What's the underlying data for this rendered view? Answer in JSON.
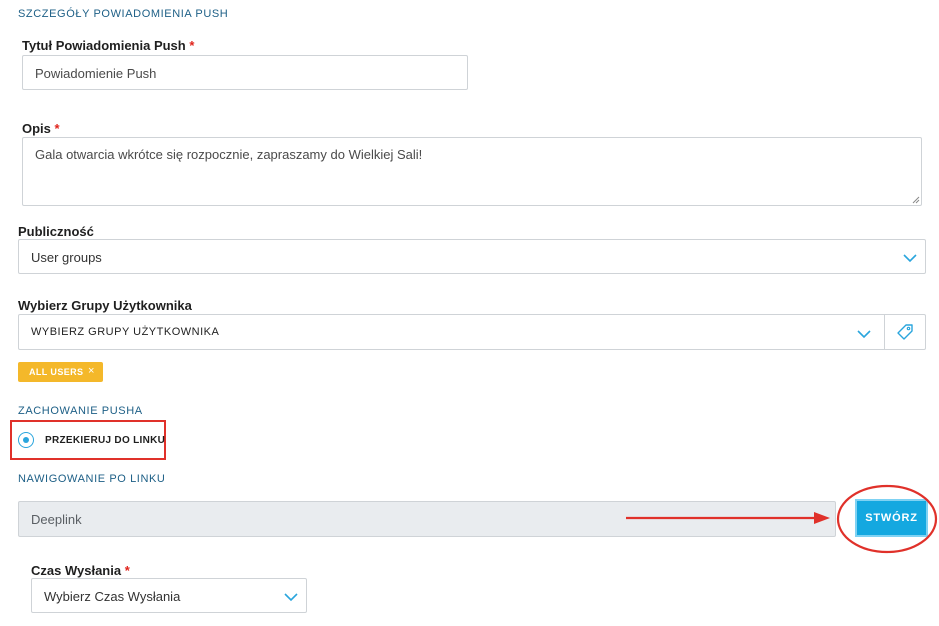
{
  "section_push_details": "SZCZEGÓŁY POWIADOMIENIA PUSH",
  "title_field": {
    "label": "Tytuł Powiadomienia Push",
    "required_mark": "*",
    "value": "Powiadomienie Push"
  },
  "description_field": {
    "label": "Opis",
    "required_mark": "*",
    "value": "Gala otwarcia wkrótce się rozpocznie, zapraszamy do Wielkiej Sali!"
  },
  "audience_field": {
    "label": "Publiczność",
    "value": "User groups"
  },
  "user_groups_field": {
    "label": "Wybierz Grupy Użytkownika",
    "placeholder": "WYBIERZ GRUPY UŻYTKOWNIKA",
    "tags": [
      {
        "label": "ALL USERS",
        "remove": "×"
      }
    ]
  },
  "section_push_behavior": "ZACHOWANIE PUSHA",
  "behavior_option": {
    "label": "PRZEKIERUJ DO LINKU",
    "selected": true
  },
  "section_link_nav": "NAWIGOWANIE PO LINKU",
  "link_field": {
    "value": "Deeplink"
  },
  "create_button": {
    "label": "STWÓRZ"
  },
  "send_time_field": {
    "label": "Czas Wysłania",
    "required_mark": "*",
    "value": "Wybierz Czas Wysłania"
  },
  "colors": {
    "accent_blue": "#14a8e0",
    "section_title": "#1d5f86",
    "tag_yellow": "#f4b82a",
    "annotation_red": "#e0312a"
  }
}
